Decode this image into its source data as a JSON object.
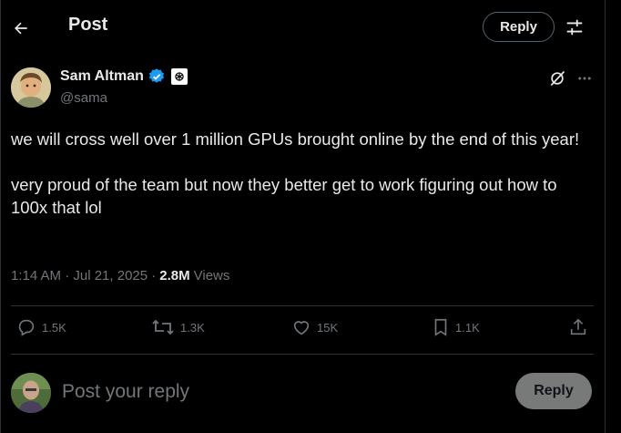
{
  "header": {
    "back_icon": "arrow-left-icon",
    "title": "Post",
    "reply_label": "Reply",
    "filter_icon": "sliders-icon"
  },
  "post": {
    "author_name": "Sam Altman",
    "verified_badge": "verified-check-icon",
    "affiliation_badge": "openai-logo-icon",
    "handle": "@sama",
    "grok_icon": "grok-icon",
    "more_icon": "more-horizontal-icon",
    "text_paragraph_1": "we will cross well over 1 million GPUs brought online by the end of this year!",
    "text_paragraph_2": "very proud of the team but now they better get to work figuring out how to 100x that lol",
    "timestamp": "1:14 AM · Jul 21, 2025 ·",
    "views_count": "2.8M",
    "views_label": "Views"
  },
  "actions": {
    "replies": "1.5K",
    "reposts": "1.3K",
    "likes": "15K",
    "bookmarks": "1.1K",
    "share_icon": "share-icon"
  },
  "composer": {
    "placeholder": "Post your reply",
    "reply_button_label": "Reply"
  },
  "colors": {
    "background": "#000000",
    "text_primary": "#e7e9ea",
    "text_secondary": "#71767b",
    "divider": "#2f3336",
    "verified_blue": "#1d9bf0",
    "reply_button_disabled": "#787a7a"
  }
}
